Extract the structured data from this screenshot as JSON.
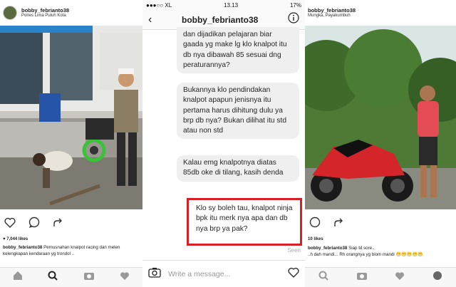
{
  "left_post": {
    "username": "bobby_febrianto38",
    "location": "Polres Lima Puluh Kota",
    "likes": "7,044 likes",
    "caption_user": "bobby_febrianto38",
    "caption_text": "Pemusnahan knalpot racing dan melen kelengkapan kendaraan yg trondol ..",
    "icons": [
      "heart-icon",
      "comment-icon",
      "share-icon"
    ],
    "tabbar_icons": [
      "home-icon",
      "search-icon",
      "camera-icon",
      "heart-icon"
    ]
  },
  "dm": {
    "status_left": "●●●○○ XL",
    "status_time": "13.13",
    "status_right": "17%",
    "title": "bobby_febrianto38",
    "messages": [
      "dan dijadikan pelajaran biar gaada yg make lg klo knalpot itu db nya dibawah 85 sesuai dng peraturannya?",
      "Bukannya klo pendindakan knalpot apapun jenisnya itu pertama harus dihitung dulu ya brp db nya? Bukan dilihat itu std atau non std",
      "Kalau emg knalpotnya diatas 85db oke di tilang, kasih denda",
      "Klo sy boleh tau, knalpot ninja bpk itu merk nya apa dan db nya brp ya pak?"
    ],
    "seen": "Seen",
    "compose_placeholder": "Write a message...",
    "highlight_color": "#d81f26"
  },
  "right_post": {
    "username": "bobby_febrianto38",
    "location": "Mungka, Payakumbuh",
    "likes": "10 likes",
    "caption_user": "bobby_febrianto38",
    "caption_text": "Siap td sore..",
    "comment_text": "..h dah mandi... Rh orangnya yg blom mandi 😁😁😁😁😁"
  }
}
